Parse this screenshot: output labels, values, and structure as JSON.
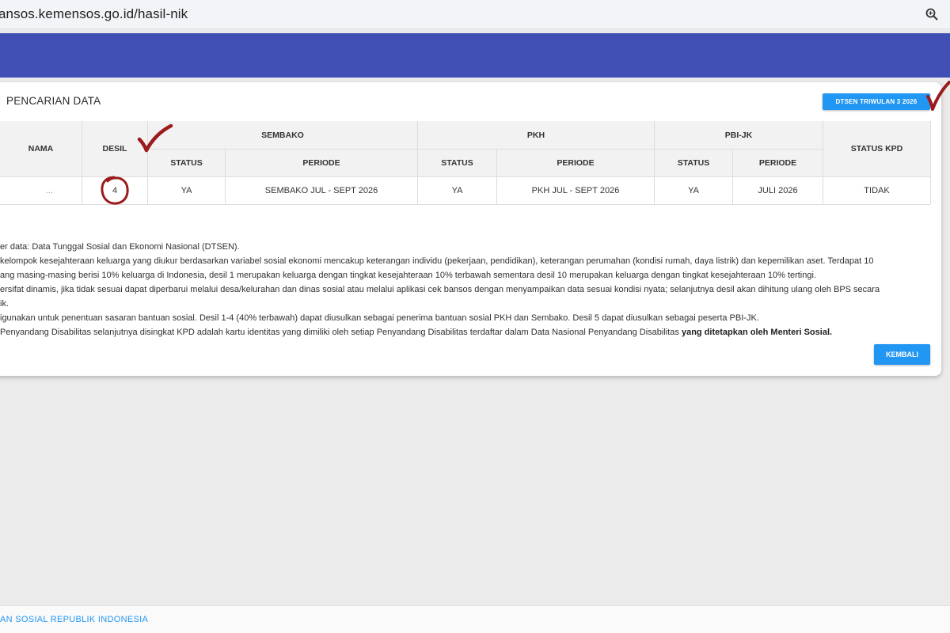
{
  "browser": {
    "url": "ansos.kemensos.go.id/hasil-nik"
  },
  "card": {
    "title": "PENCARIAN DATA",
    "dtsen_button": "DTSEN TRIWULAN 3 2026"
  },
  "table": {
    "headers": {
      "nama": "NAMA",
      "desil": "DESIL",
      "sembako": "SEMBAKO",
      "pkh": "PKH",
      "pbijk": "PBI-JK",
      "status_kpd": "STATUS KPD",
      "status": "STATUS",
      "periode": "PERIODE"
    },
    "row": {
      "nama": "...",
      "desil": "4",
      "sembako_status": "YA",
      "sembako_periode": "SEMBAKO JUL - SEPT 2026",
      "pkh_status": "YA",
      "pkh_periode": "PKH JUL - SEPT 2026",
      "pbijk_status": "YA",
      "pbijk_periode": "JULI 2026",
      "status_kpd": "TIDAK"
    }
  },
  "notes": {
    "line1": "er data: Data Tunggal Sosial dan Ekonomi Nasional (DTSEN).",
    "line2": "kelompok kesejahteraan keluarga yang diukur berdasarkan variabel sosial ekonomi mencakup keterangan individu (pekerjaan, pendidikan), keterangan perumahan (kondisi rumah, daya listrik) dan kepemilikan aset. Terdapat 10",
    "line3": "ang masing-masing berisi 10% keluarga di Indonesia, desil 1 merupakan keluarga dengan tingkat kesejahteraan 10% terbawah sementara desil 10 merupakan keluarga dengan tingkat kesejahteraan 10% tertingi.",
    "line4": "ersifat dinamis, jika tidak sesuai dapat diperbarui melalui desa/kelurahan dan dinas sosial atau melalui aplikasi cek bansos dengan menyampaikan data sesuai kondisi nyata; selanjutnya desil akan dihitung ulang oleh BPS secara",
    "line5": "ik.",
    "line6": "igunakan untuk penentuan sasaran bantuan sosial. Desil 1-4 (40% terbawah) dapat diusulkan sebagai penerima bantuan sosial PKH dan Sembako. Desil 5 dapat diusulkan sebagai peserta PBI-JK.",
    "line7_pre": "Penyandang Disabilitas selanjutnya disingkat KPD adalah kartu identitas yang dimiliki oleh setiap Penyandang Disabilitas terdaftar dalam Data Nasional Penyandang Disabilitas ",
    "line7_bold": "yang ditetapkan oleh Menteri Sosial."
  },
  "kembali_button": "KEMBALI",
  "footer": {
    "text": "AN SOSIAL REPUBLIK INDONESIA"
  },
  "colors": {
    "nav": "#4050b5",
    "button": "#2196f3",
    "annotation": "#9b1b1b"
  },
  "icons": [
    "search-icon",
    "checkmark-annotation",
    "circle-annotation"
  ]
}
